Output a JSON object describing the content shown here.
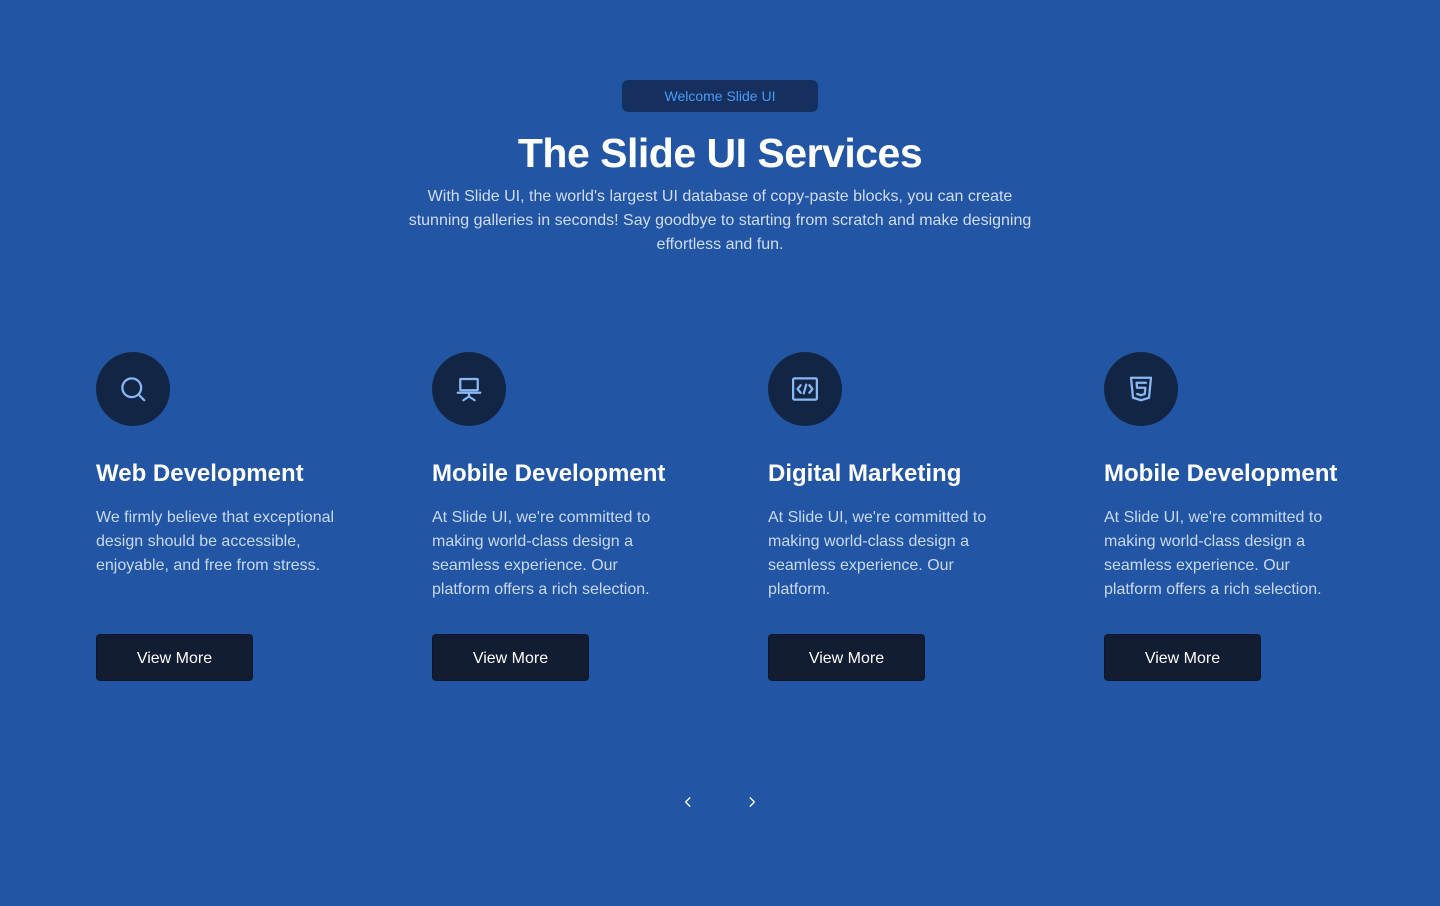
{
  "hero": {
    "badge": "Welcome Slide UI",
    "title": "The Slide UI Services",
    "subtitle": "With Slide UI, the world's largest UI database of copy-paste blocks, you can create stunning galleries in seconds! Say goodbye to starting from scratch and make designing effortless and fun."
  },
  "cards": [
    {
      "icon": "search-icon",
      "title": "Web Development",
      "text": "We firmly believe that exceptional design should be accessible, enjoyable, and free from stress.",
      "button": "View More"
    },
    {
      "icon": "presentation-icon",
      "title": "Mobile Development",
      "text": "At Slide UI, we're committed to making world-class design a seamless experience. Our platform offers a rich selection.",
      "button": "View More"
    },
    {
      "icon": "code-icon",
      "title": "Digital Marketing",
      "text": "At Slide UI, we're committed to making world-class design a seamless experience. Our platform.",
      "button": "View More"
    },
    {
      "icon": "html5-icon",
      "title": "Mobile Development",
      "text": "At Slide UI, we're committed to making world-class design a seamless experience. Our platform offers a rich selection.",
      "button": "View More"
    }
  ],
  "carousel": {
    "prev_icon": "chevron-left-icon",
    "next_icon": "chevron-right-icon"
  },
  "colors": {
    "background": "#2255a4",
    "badge_bg": "#15305f",
    "badge_text": "#4a9bf5",
    "icon_circle": "#132544",
    "button_bg": "#121c33",
    "icon_stroke": "#8ab8f2"
  }
}
